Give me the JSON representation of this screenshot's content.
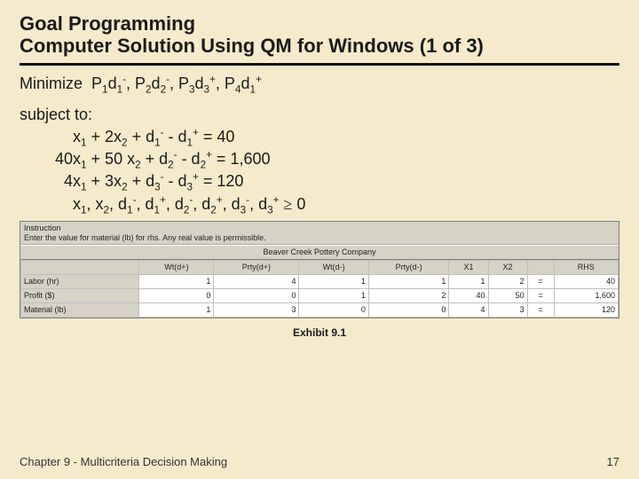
{
  "title_line1": "Goal Programming",
  "title_line2": "Computer Solution Using QM for Windows (1 of 3)",
  "minimize_prefix": "Minimize",
  "min_terms": [
    {
      "p": "P",
      "psub": "1",
      "d": "d",
      "dsub": "1",
      "dsup": "-"
    },
    {
      "p": "P",
      "psub": "2",
      "d": "d",
      "dsub": "2",
      "dsup": "-"
    },
    {
      "p": "P",
      "psub": "3",
      "d": "d",
      "dsub": "3",
      "dsup": "+"
    },
    {
      "p": "P",
      "psub": "4",
      "d": "d",
      "dsub": "1",
      "dsup": "+"
    }
  ],
  "subject_label": "subject to:",
  "c1": {
    "lhs1": "x",
    "lhs1s": "1",
    "plus1": " + 2x",
    "lhs2s": "2",
    "plus2": " + d",
    "d1s": "1",
    "d1p": "-",
    "minus": " - d",
    "d2s": "1",
    "d2p": "+",
    "eq": " = 40"
  },
  "c2": {
    "a": "40x",
    "as": "1",
    "b": " + 50 x",
    "bs": "2",
    "c": " + d",
    "cs": "2",
    "cp": "-",
    "d": " - d",
    "ds": "2",
    "dp": "+",
    "eq": " = 1,600"
  },
  "c3": {
    "a": "4x",
    "as": "1",
    "b": " + 3x",
    "bs": "2",
    "c": " + d",
    "cs": "3",
    "cp": "-",
    "d": " - d",
    "ds": "3",
    "dp": "+",
    "eq": " = 120"
  },
  "nonneg": {
    "vars": [
      "x1",
      "x2",
      "d1-",
      "d1+",
      "d2-",
      "d2+",
      "d3-",
      "d3+"
    ],
    "op": "≥",
    "rhs": "0"
  },
  "window": {
    "instruction_title": "Instruction",
    "instruction_text": "Enter the value for material (lb) for rhs. Any real value is permissible.",
    "company": "Beaver Creek Pottery Company",
    "headers": [
      "",
      "Wt(d+)",
      "Prty(d+)",
      "Wt(d-)",
      "Prty(d-)",
      "X1",
      "X2",
      "",
      "RHS"
    ],
    "rows": [
      {
        "label": "Labor (hr)",
        "cells": [
          "1",
          "4",
          "1",
          "1",
          "1",
          "2",
          "="
        ],
        "rhs": "40"
      },
      {
        "label": "Profit ($)",
        "cells": [
          "0",
          "0",
          "1",
          "2",
          "40",
          "50",
          "="
        ],
        "rhs": "1,600"
      },
      {
        "label": "Material (lb)",
        "cells": [
          "1",
          "3",
          "0",
          "0",
          "4",
          "3",
          "="
        ],
        "rhs": "120"
      }
    ]
  },
  "exhibit": "Exhibit 9.1",
  "footer_left": "Chapter 9 - Multicriteria Decision Making",
  "footer_right": "17"
}
